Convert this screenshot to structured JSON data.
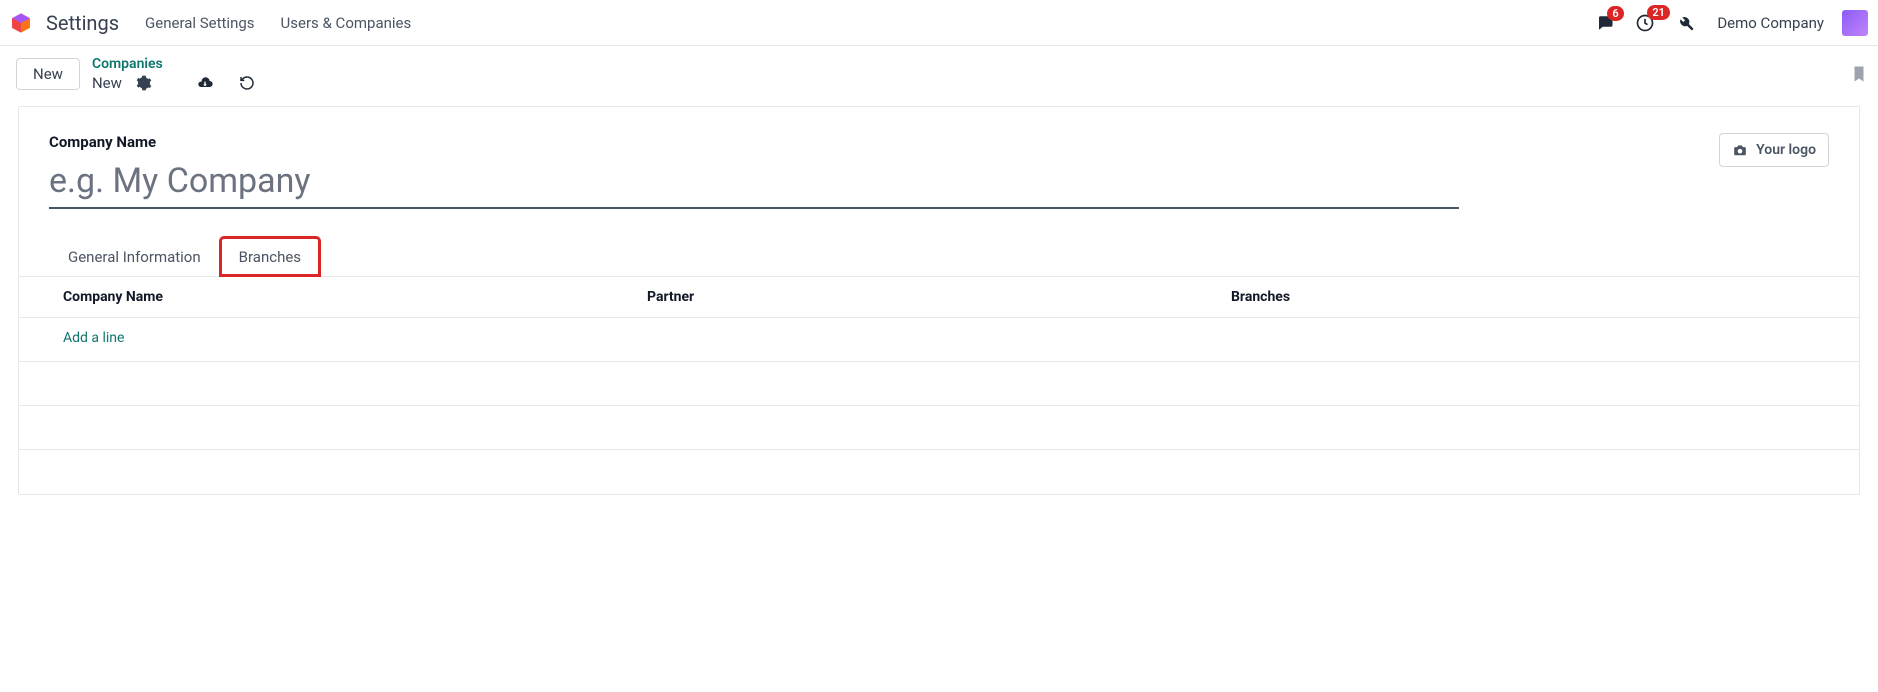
{
  "topbar": {
    "app_name": "Settings",
    "nav": {
      "general": "General Settings",
      "users_companies": "Users & Companies"
    },
    "badges": {
      "discuss": "6",
      "activities": "21"
    },
    "company": "Demo Company"
  },
  "actionbar": {
    "new_button": "New",
    "breadcrumb_link": "Companies",
    "record_name": "New"
  },
  "sheet": {
    "company_name_label": "Company Name",
    "company_name_placeholder": "e.g. My Company",
    "logo_button": "Your logo",
    "tabs": {
      "general_info": "General Information",
      "branches": "Branches"
    },
    "table": {
      "headers": {
        "company_name": "Company Name",
        "partner": "Partner",
        "branches": "Branches"
      },
      "add_line": "Add a line"
    }
  }
}
